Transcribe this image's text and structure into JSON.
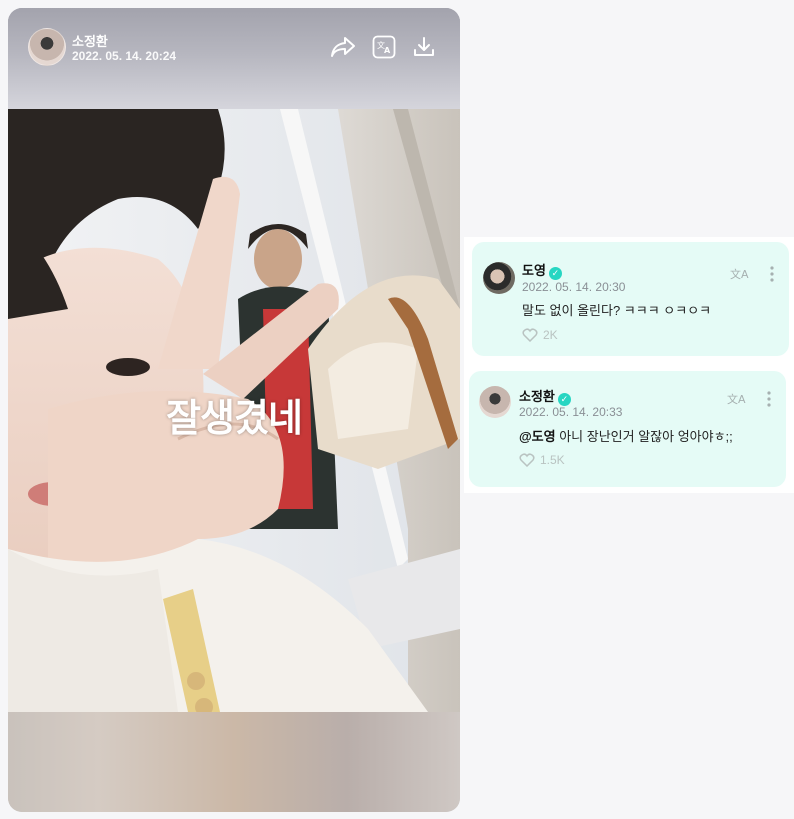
{
  "post": {
    "author_name": "소정환",
    "timestamp": "2022. 05. 14. 20:24",
    "overlay_text": "잘생겼네"
  },
  "icons": {
    "share": "share-icon",
    "translate": "translate-icon",
    "download": "download-icon",
    "more": "more-vertical-icon",
    "like": "like-icon",
    "verified": "verified-badge-icon"
  },
  "comments": [
    {
      "name": "도영",
      "timestamp": "2022. 05. 14. 20:30",
      "text": "말도 없이 올린다? ㅋㅋㅋ ㅇㅋㅇㅋ",
      "likes": "2K"
    },
    {
      "name": "소정환",
      "timestamp": "2022. 05. 14. 20:33",
      "mention": "@도영",
      "text": " 아니 장난인거 알잖아 엉아야ㅎ;;",
      "likes": "1.5K"
    }
  ],
  "colors": {
    "comment_bg": "#e5fbf6",
    "verified": "#27d6c2",
    "page_bg": "#f6f6f8"
  }
}
